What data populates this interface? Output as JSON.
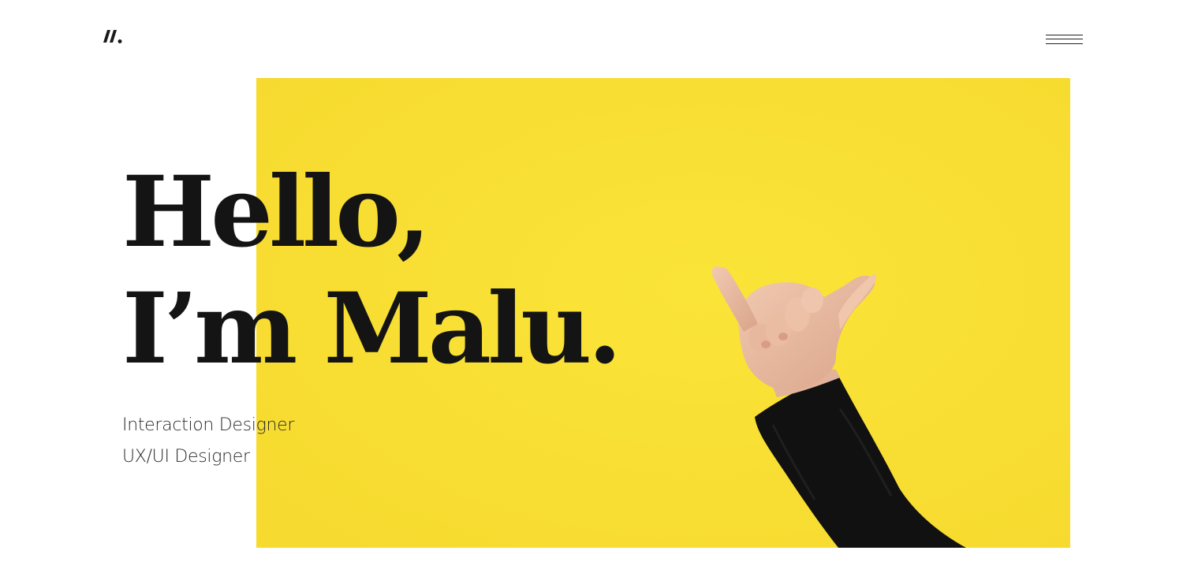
{
  "header": {
    "logo_icon": "slash-dot-logo-icon",
    "menu_icon": "hamburger-menu-icon"
  },
  "hero": {
    "headline_line1": "Hello,",
    "headline_line2": "I’m Malu.",
    "roles": [
      "Interaction Designer",
      "UX/UI Designer"
    ],
    "image_icon": "shaka-hand-photo"
  },
  "colors": {
    "accent_yellow": "#f8dc30",
    "text_dark": "#141414",
    "background": "#ffffff"
  }
}
